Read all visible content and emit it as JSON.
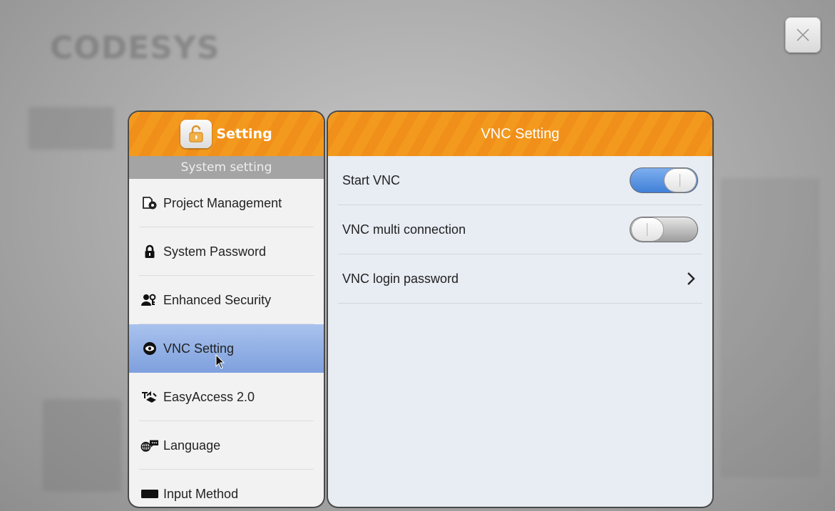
{
  "background": {
    "brand_text": "CODESYS"
  },
  "close_icon": "close-icon",
  "left_panel": {
    "title": "Setting",
    "section_label": "System setting",
    "items": [
      {
        "label": "Project Management",
        "icon": "project-management-icon"
      },
      {
        "label": "System Password",
        "icon": "lock-icon"
      },
      {
        "label": "Enhanced Security",
        "icon": "users-key-icon"
      },
      {
        "label": "VNC Setting",
        "icon": "eye-icon",
        "selected": true
      },
      {
        "label": "EasyAccess 2.0",
        "icon": "easyaccess-icon"
      },
      {
        "label": "Language",
        "icon": "globe-chat-icon"
      },
      {
        "label": "Input Method",
        "icon": "keyboard-icon"
      }
    ]
  },
  "right_panel": {
    "title": "VNC Setting",
    "rows": [
      {
        "label": "Start VNC",
        "control": "toggle",
        "on": true
      },
      {
        "label": "VNC multi connection",
        "control": "toggle",
        "on": false
      },
      {
        "label": "VNC login password",
        "control": "chevron"
      }
    ]
  },
  "colors": {
    "accent_orange": "#f39a1e",
    "selected_blue": "#7ea0dd",
    "toggle_on": "#3f7fd6"
  }
}
